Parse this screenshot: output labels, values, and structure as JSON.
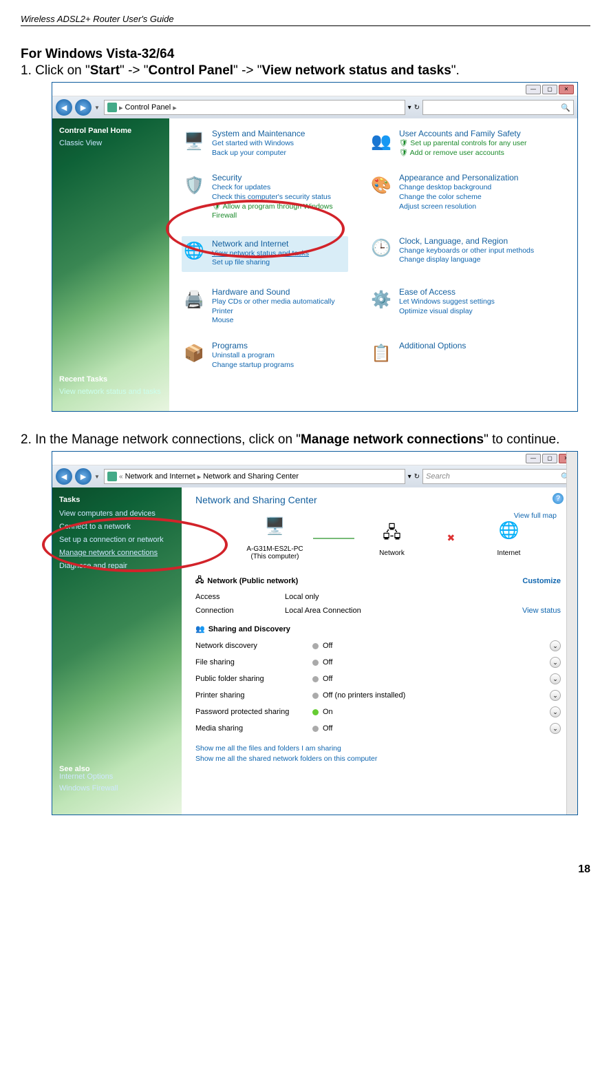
{
  "header": "Wireless ADSL2+ Router User's Guide",
  "section": "For Windows Vista-32/64",
  "step1": {
    "num": "1.",
    "t1": "Click on \"",
    "s1": "Start",
    "t2": "\" -> \"",
    "s2": "Control Panel",
    "t3": "\" -> \"",
    "s3": "View network status and tasks",
    "t4": "\"."
  },
  "win1": {
    "breadcrumb_item": "Control Panel",
    "sidebar": {
      "home": "Control Panel Home",
      "classic": "Classic View",
      "recent_h": "Recent Tasks",
      "recent": "View network status and tasks"
    },
    "cats": {
      "sysm": "System and Maintenance",
      "sysm_l1": "Get started with Windows",
      "sysm_l2": "Back up your computer",
      "sec": "Security",
      "sec_l1": "Check for updates",
      "sec_l2": "Check this computer's security status",
      "sec_l3": "Allow a program through Windows Firewall",
      "net": "Network and Internet",
      "net_l1": "View network status and tasks",
      "net_l2": "Set up file sharing",
      "hw": "Hardware and Sound",
      "hw_l1": "Play CDs or other media automatically",
      "hw_l2": "Printer",
      "hw_l3": "Mouse",
      "prog": "Programs",
      "prog_l1": "Uninstall a program",
      "prog_l2": "Change startup programs",
      "ua": "User Accounts and Family Safety",
      "ua_l1": "Set up parental controls for any user",
      "ua_l2": "Add or remove user accounts",
      "ap": "Appearance and Personalization",
      "ap_l1": "Change desktop background",
      "ap_l2": "Change the color scheme",
      "ap_l3": "Adjust screen resolution",
      "cl": "Clock, Language, and Region",
      "cl_l1": "Change keyboards or other input methods",
      "cl_l2": "Change display language",
      "ea": "Ease of Access",
      "ea_l1": "Let Windows suggest settings",
      "ea_l2": "Optimize visual display",
      "ao": "Additional Options"
    }
  },
  "step2": {
    "num": "2.",
    "t1": "In the Manage network connections, click on \"",
    "s1": "Manage network connections",
    "t2": "\" to continue."
  },
  "win2": {
    "breadcrumb1": "Network and Internet",
    "breadcrumb2": "Network and Sharing Center",
    "search_ph": "Search",
    "tasks_h": "Tasks",
    "t1": "View computers and devices",
    "t2": "Connect to a network",
    "t3": "Set up a connection or network",
    "t4": "Manage network connections",
    "t5": "Diagnose and repair",
    "seealso": "See also",
    "sa1": "Internet Options",
    "sa2": "Windows Firewall",
    "title": "Network and Sharing Center",
    "fullmap": "View full map",
    "node1": "A-G31M-ES2L-PC",
    "node1b": "(This computer)",
    "node2": "Network",
    "node3": "Internet",
    "summary_h": "Network (Public network)",
    "customize": "Customize",
    "access": "Access",
    "access_v": "Local only",
    "connection": "Connection",
    "connection_v": "Local Area Connection",
    "viewstatus": "View status",
    "sharing_h": "Sharing and Discovery",
    "rows": {
      "nd": "Network discovery",
      "nd_v": "Off",
      "fs": "File sharing",
      "fs_v": "Off",
      "pf": "Public folder sharing",
      "pf_v": "Off",
      "ps": "Printer sharing",
      "ps_v": "Off (no printers installed)",
      "pp": "Password protected sharing",
      "pp_v": "On",
      "ms": "Media sharing",
      "ms_v": "Off"
    },
    "bl1": "Show me all the files and folders I am sharing",
    "bl2": "Show me all the shared network folders on this computer"
  },
  "pagenum": "18"
}
